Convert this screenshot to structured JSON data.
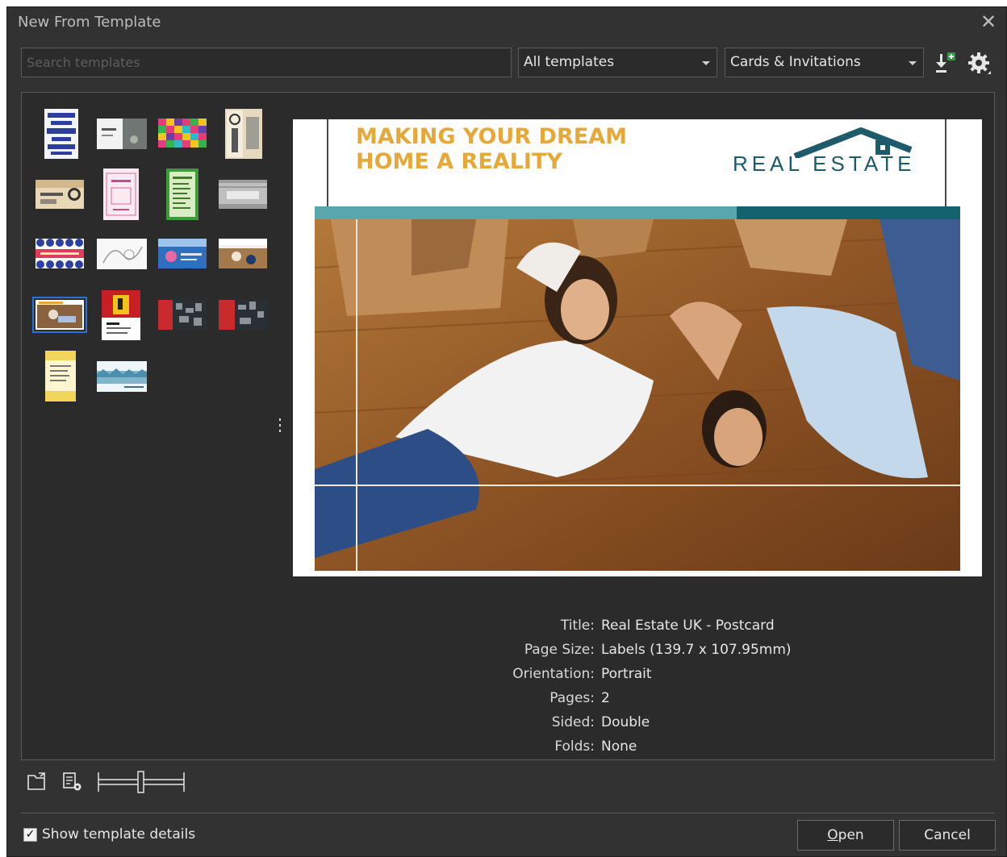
{
  "window": {
    "title": "New From Template",
    "close_glyph": "✕"
  },
  "toolbar": {
    "search_placeholder": "Search templates",
    "source_combo": "All templates",
    "category_combo": "Cards & Invitations",
    "import_icon": "import-template-icon",
    "options_icon": "gear-icon"
  },
  "preview": {
    "headline_line1": "MAKING YOUR DREAM",
    "headline_line2": "HOME A REALITY",
    "brand": "REAL ESTATE"
  },
  "details": {
    "title_label": "Title:",
    "title_value": "Real Estate UK - Postcard",
    "page_size_label": "Page Size:",
    "page_size_value": "Labels (139.7 x 107.95mm)",
    "orientation_label": "Orientation:",
    "orientation_value": "Portrait",
    "pages_label": "Pages:",
    "pages_value": "2",
    "sided_label": "Sided:",
    "sided_value": "Double",
    "folds_label": "Folds:",
    "folds_value": "None"
  },
  "footer": {
    "show_details_label": "Show template details",
    "show_details_checked": true,
    "open_mnemonic": "O",
    "open_rest": "pen",
    "cancel_label": "Cancel"
  },
  "colors": {
    "dialog_bg": "#323232",
    "panel_bg": "#2b2b2b",
    "border": "#5a5a5a",
    "selection": "#2f6fd6",
    "headline_orange": "#e7a83a",
    "brand_teal": "#1d5a6a"
  }
}
